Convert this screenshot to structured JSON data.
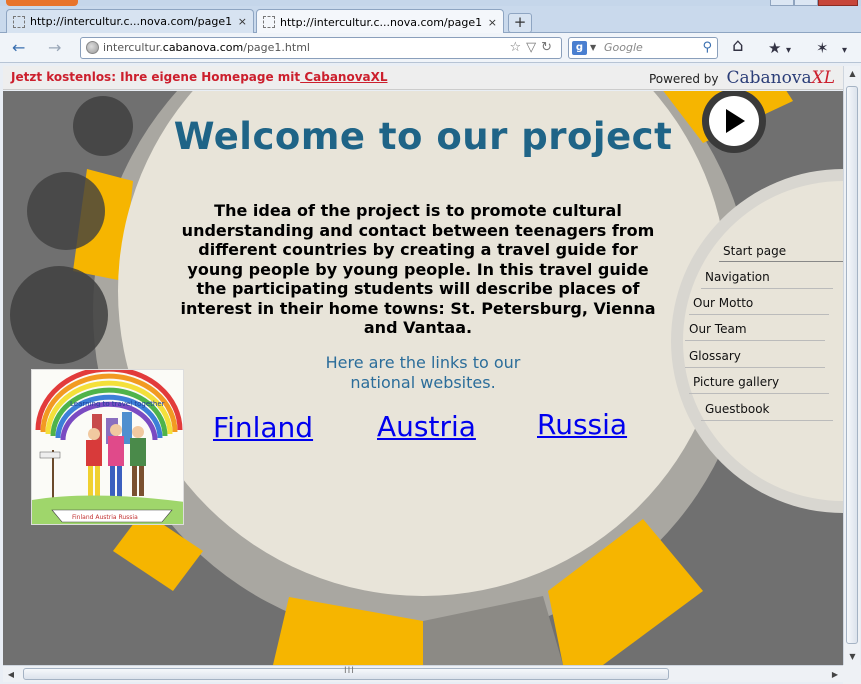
{
  "browser": {
    "tabs": [
      {
        "title": "http://intercultur.c...nova.com/page1.html",
        "close": "×",
        "active": false
      },
      {
        "title": "http://intercultur.c...nova.com/page1.html",
        "close": "×",
        "active": true
      }
    ],
    "new_tab": "+",
    "url": {
      "prefix": "intercultur.",
      "host": "cabanova.com",
      "path": "/page1.html"
    },
    "search_placeholder": "Google",
    "search_engine_badge": "g"
  },
  "banner": {
    "promo_prefix": "Jetzt kostenlos: Ihre eigene Homepage mit",
    "promo_link": " CabanovaXL",
    "powered_by": "Powered by",
    "brand": "Cabanova",
    "brand_suffix": "XL"
  },
  "page": {
    "heading": "Welcome to our project",
    "intro": "The idea of the project is to promote cultural understanding and contact between teenagers from different countries by creating a travel guide for young people by young people. In this travel guide the participating students will describe places of interest in their home towns: St. Petersburg, Vienna and Vantaa.",
    "links_caption_line1": "Here are the links to our",
    "links_caption_line2": "national websites.",
    "links": {
      "finland": "Finland",
      "austria": "Austria",
      "russia": "Russia"
    },
    "drawing_text": {
      "top": "Learning to travel together",
      "bottom": "Finland Austria Russia"
    }
  },
  "menu": [
    {
      "label": "Start page"
    },
    {
      "label": "Navigation"
    },
    {
      "label": "Our Motto"
    },
    {
      "label": "Our Team"
    },
    {
      "label": "Glossary"
    },
    {
      "label": "Picture gallery"
    },
    {
      "label": "Guestbook"
    }
  ],
  "colors": {
    "accent_yellow": "#f6b500",
    "cream": "#e8e4d9",
    "ring_gray": "#a9a7a1",
    "bg_gray": "#707070",
    "heading_blue": "#1f6487",
    "banner_red": "#cc1f2d"
  },
  "icons": {
    "back": "←",
    "forward": "→",
    "reload": "↻",
    "star": "☆",
    "dropdown": "▽",
    "search": "⚲",
    "home": "⌂",
    "bookmarks": "★",
    "addon": "✶",
    "overflow": "▾",
    "scroll_up": "▲",
    "scroll_down": "▼",
    "scroll_left": "◀",
    "scroll_right": "▶",
    "grip": "III"
  }
}
